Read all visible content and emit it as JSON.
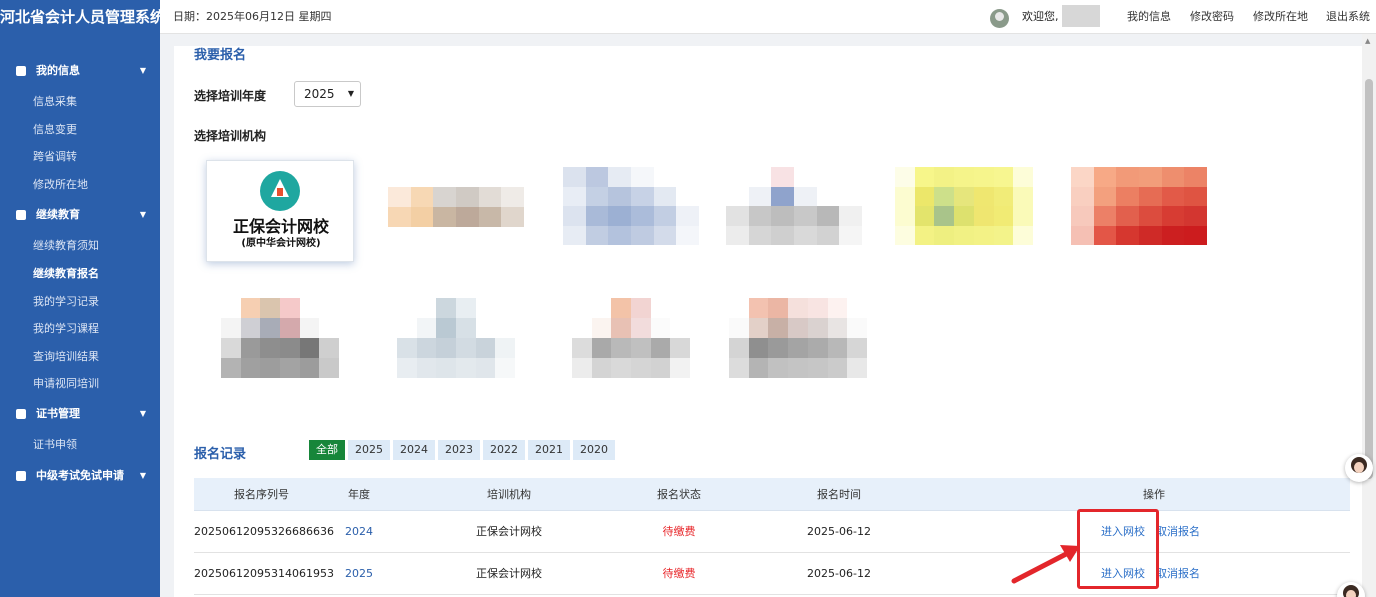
{
  "app": {
    "title": "河北省会计人员管理系统",
    "brand_color": "#2b5fab"
  },
  "header": {
    "date_text": "日期：2025年06月12日 星期四",
    "welcome": "欢迎您,",
    "links": [
      "我的信息",
      "修改密码",
      "修改所在地",
      "退出系统"
    ]
  },
  "sidebar": {
    "groups": [
      {
        "label": "我的信息",
        "icon": "user-icon",
        "items": [
          "信息采集",
          "信息变更",
          "跨省调转",
          "修改所在地"
        ]
      },
      {
        "label": "继续教育",
        "icon": "edit-icon",
        "items": [
          "继续教育须知",
          "继续教育报名",
          "我的学习记录",
          "我的学习课程",
          "查询培训结果",
          "申请视同培训"
        ],
        "active_item": "继续教育报名"
      },
      {
        "label": "证书管理",
        "icon": "id-card-icon",
        "items": [
          "证书申领"
        ]
      },
      {
        "label": "中级考试免试申请",
        "icon": "id-card-icon",
        "items": []
      }
    ]
  },
  "main": {
    "section_title": "我要报名",
    "year_label": "选择培训年度",
    "year_value": "2025",
    "institution_label": "选择培训机构",
    "featured_institution": {
      "name": "正保会计网校",
      "subtitle": "(原中华会计网校)"
    },
    "records_title": "报名记录",
    "record_tabs": [
      "全部",
      "2025",
      "2024",
      "2023",
      "2022",
      "2021",
      "2020"
    ],
    "active_tab": "全部",
    "table": {
      "headers": [
        "报名序列号",
        "年度",
        "培训机构",
        "报名状态",
        "报名时间",
        "操作"
      ],
      "rows": [
        {
          "serial": "20250612095326686636",
          "year": "2024",
          "institution": "正保会计网校",
          "status": "待缴费",
          "date": "2025-06-12",
          "actions": [
            "进入网校",
            "取消报名"
          ]
        },
        {
          "serial": "20250612095314061953",
          "year": "2025",
          "institution": "正保会计网校",
          "status": "待缴费",
          "date": "2025-06-12",
          "actions": [
            "进入网校",
            "取消报名"
          ]
        }
      ]
    }
  },
  "colors": {
    "status_red": "#e8272b",
    "active_tab_green": "#17863a",
    "annotation_red": "#e3262b"
  }
}
